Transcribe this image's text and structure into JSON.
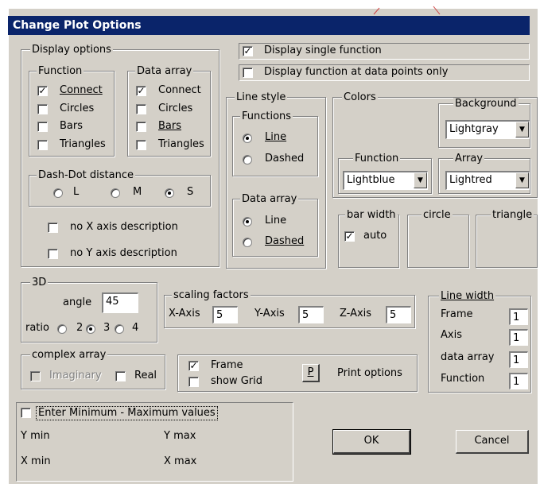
{
  "window": {
    "title": "Change Plot Options"
  },
  "display_options": {
    "legend": "Display options",
    "function": {
      "legend": "Function",
      "items": [
        "Connect",
        "Circles",
        "Bars",
        "Triangles"
      ],
      "checked": [
        true,
        false,
        false,
        false
      ]
    },
    "data_array": {
      "legend": "Data array",
      "items": [
        "Connect",
        "Circles",
        "Bars",
        "Triangles"
      ],
      "checked": [
        true,
        false,
        false,
        false
      ]
    },
    "dash_dot": {
      "legend": "Dash-Dot distance",
      "options": [
        "L",
        "M",
        "S"
      ],
      "selected": "S"
    },
    "no_x_axis": "no X axis description",
    "no_y_axis": "no Y axis description"
  },
  "top_checks": {
    "single_function": "Display single function",
    "single_checked": true,
    "at_data_points": "Display function at data points only",
    "at_data_checked": false
  },
  "line_style": {
    "legend": "Line style",
    "functions": {
      "legend": "Functions",
      "options": [
        "Line",
        "Dashed"
      ],
      "selected": "Line"
    },
    "data_array": {
      "legend": "Data array",
      "options": [
        "Line",
        "Dashed"
      ],
      "selected": "Line"
    }
  },
  "colors": {
    "legend": "Colors",
    "background": {
      "legend": "Background",
      "value": "Lightgray"
    },
    "function": {
      "legend": "Function",
      "value": "Lightblue"
    },
    "array": {
      "legend": "Array",
      "value": "Lightred"
    }
  },
  "bar_width": {
    "legend": "bar width",
    "auto": "auto",
    "auto_checked": true
  },
  "circle": {
    "legend": "circle"
  },
  "triangle": {
    "legend": "triangle"
  },
  "three_d": {
    "legend": "3D",
    "angle_label": "angle",
    "angle_value": "45",
    "ratio_label": "ratio",
    "ratio_options": [
      "2",
      "3",
      "4"
    ],
    "ratio_selected": "3"
  },
  "scaling": {
    "legend": "scaling factors",
    "x_label": "X-Axis",
    "x_value": "5",
    "y_label": "Y-Axis",
    "y_value": "5",
    "z_label": "Z-Axis",
    "z_value": "5"
  },
  "line_width": {
    "legend": "Line width",
    "rows": [
      {
        "label": "Frame",
        "value": "1"
      },
      {
        "label": "Axis",
        "value": "1"
      },
      {
        "label": "data array",
        "value": "1"
      },
      {
        "label": "Function",
        "value": "1"
      }
    ]
  },
  "complex_array": {
    "legend": "complex array",
    "imaginary": "Imaginary",
    "real": "Real"
  },
  "frame_grid": {
    "frame": "Frame",
    "frame_checked": true,
    "grid": "show Grid",
    "grid_checked": false,
    "print_key": "P",
    "print_options": "Print options"
  },
  "minmax": {
    "label": "Enter Minimum - Maximum values",
    "y_min": "Y min",
    "y_max": "Y max",
    "x_min": "X min",
    "x_max": "X max"
  },
  "buttons": {
    "ok": "OK",
    "cancel": "Cancel"
  }
}
